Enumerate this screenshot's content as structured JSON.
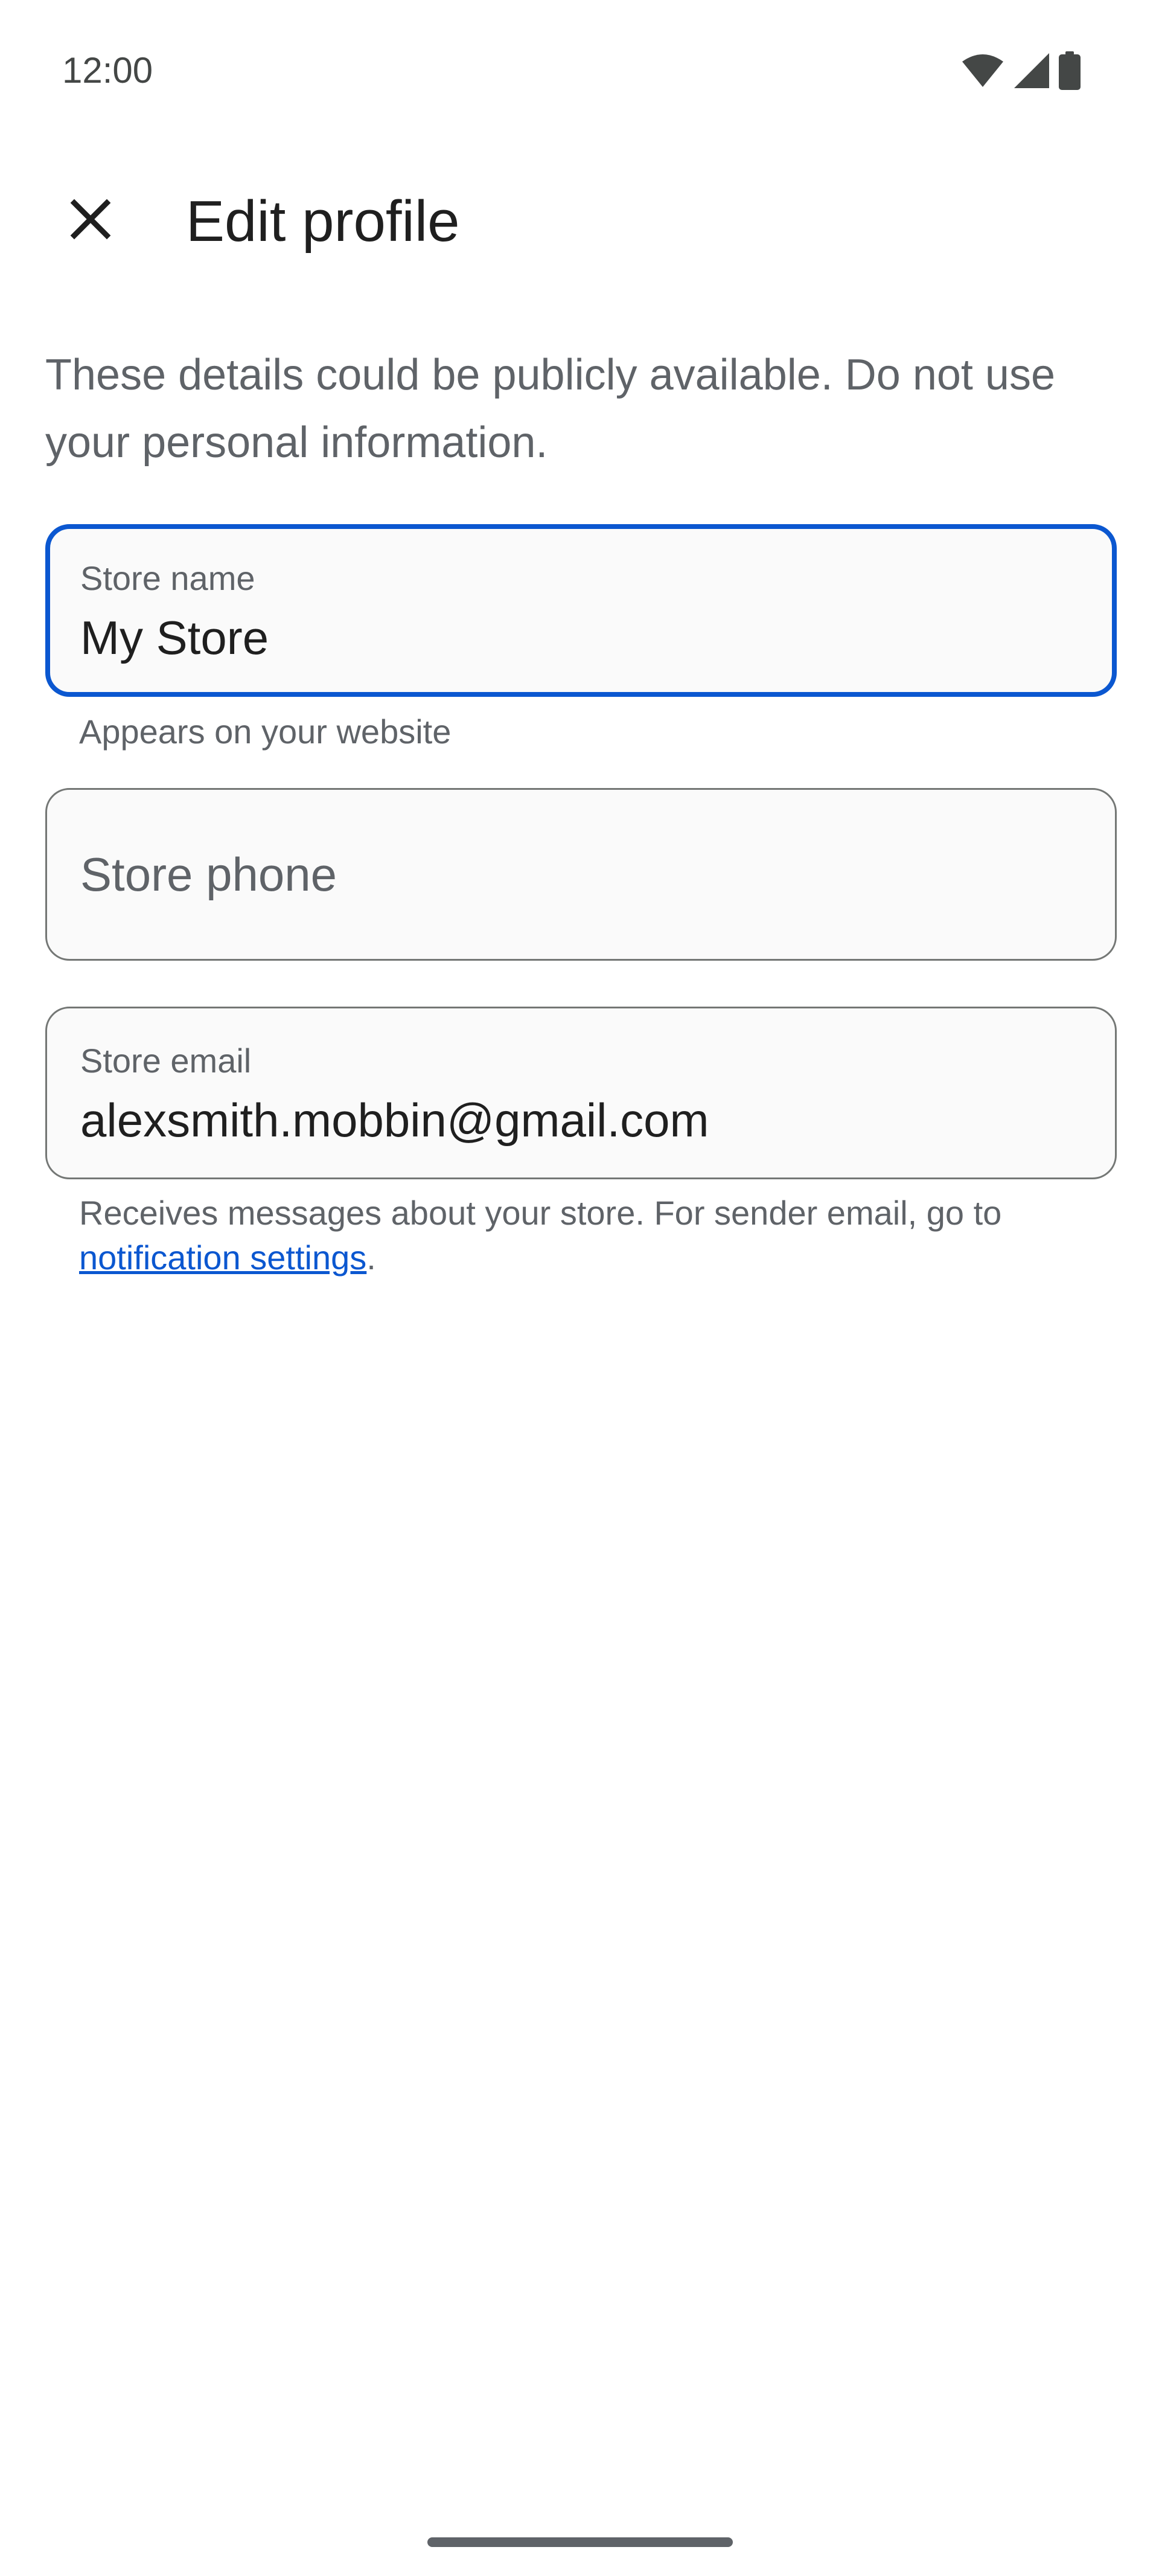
{
  "status_bar": {
    "time": "12:00",
    "icons": [
      "wifi-icon",
      "signal-icon",
      "battery-icon"
    ]
  },
  "app_bar": {
    "close_icon": "close-icon",
    "title": "Edit profile"
  },
  "intro_text": "These details could be publicly available. Do not use your personal information.",
  "fields": {
    "store_name": {
      "label": "Store name",
      "value": "My Store",
      "helper": "Appears on your website",
      "focused": true
    },
    "store_phone": {
      "placeholder": "Store phone",
      "value": ""
    },
    "store_email": {
      "label": "Store email",
      "value": "alexsmith.mobbin@gmail.com",
      "helper_prefix": "Receives messages about your store. For sender email, go to",
      "helper_link": "notification settings",
      "helper_suffix": "."
    }
  },
  "colors": {
    "accent": "#0b57d0",
    "text_primary": "#1f1f1f",
    "text_secondary": "#5f6368",
    "outline": "#747775"
  }
}
